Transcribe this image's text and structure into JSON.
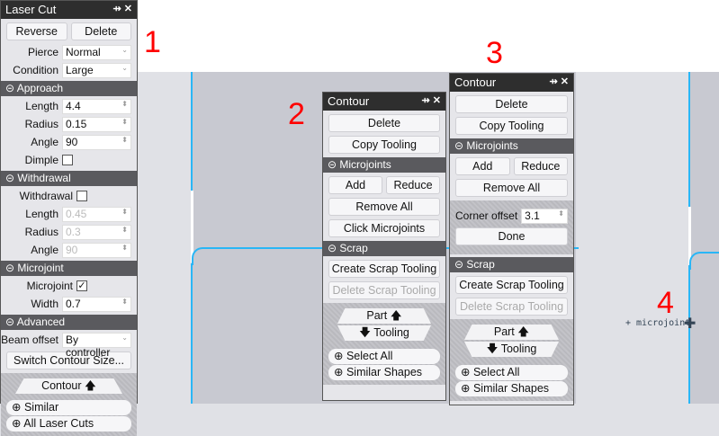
{
  "laser_cut": {
    "title": "Laser Cut",
    "reverse": "Reverse",
    "delete": "Delete",
    "pierce_label": "Pierce",
    "pierce": "Normal",
    "condition_label": "Condition",
    "condition": "Large",
    "approach": "Approach",
    "length_label": "Length",
    "length": "4.4",
    "radius_label": "Radius",
    "radius": "0.15",
    "angle_label": "Angle",
    "angle": "90",
    "dimple_label": "Dimple",
    "withdrawal": "Withdrawal",
    "withdrawal_label": "Withdrawal",
    "w_length": "0.45",
    "w_radius": "0.3",
    "w_angle": "90",
    "microjoint": "Microjoint",
    "microjoint_label": "Microjoint",
    "width_label": "Width",
    "width": "0.7",
    "advanced": "Advanced",
    "beam_label": "Beam offset",
    "beam": "By controller",
    "switch": "Switch Contour Size...",
    "contour": "Contour",
    "similar": "Similar",
    "all": "All Laser Cuts"
  },
  "contour2": {
    "title": "Contour",
    "delete": "Delete",
    "copy": "Copy Tooling",
    "microjoints": "Microjoints",
    "add": "Add",
    "reduce": "Reduce",
    "remove_all": "Remove All",
    "click": "Click Microjoints",
    "scrap": "Scrap",
    "create": "Create Scrap Tooling",
    "delete_scrap": "Delete Scrap Tooling",
    "part": "Part",
    "tooling": "Tooling",
    "select_all": "Select All",
    "similar": "Similar Shapes"
  },
  "contour3": {
    "title": "Contour",
    "delete": "Delete",
    "copy": "Copy Tooling",
    "microjoints": "Microjoints",
    "add": "Add",
    "reduce": "Reduce",
    "remove_all": "Remove All",
    "corner_label": "Corner offset",
    "corner": "3.1",
    "done": "Done",
    "scrap": "Scrap",
    "create": "Create Scrap Tooling",
    "delete_scrap": "Delete Scrap Tooling",
    "part": "Part",
    "tooling": "Tooling",
    "select_all": "Select All",
    "similar": "Similar Shapes"
  },
  "canvas": {
    "cursor_label": "+ microjoint",
    "annotations": [
      "1",
      "2",
      "3",
      "4"
    ],
    "accent": "#29b6f6"
  }
}
